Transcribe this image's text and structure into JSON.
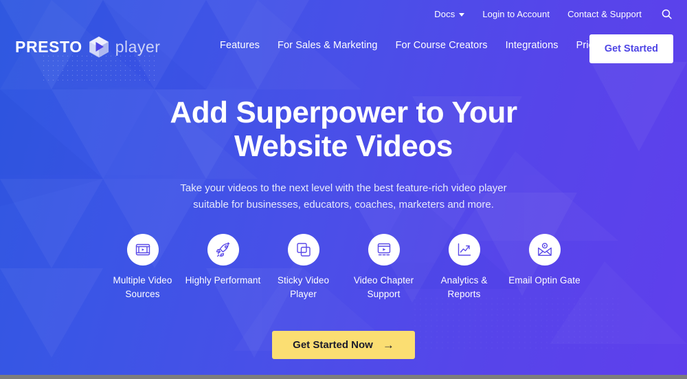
{
  "site": {
    "logo_primary": "PRESTO",
    "logo_secondary": "player",
    "logo_icon": "hexagon-play-icon"
  },
  "topbar": {
    "items": [
      {
        "label": "Docs",
        "icon": "chevron-down-icon",
        "has_caret": true
      },
      {
        "label": "Login to Account",
        "has_caret": false
      },
      {
        "label": "Contact & Support",
        "has_caret": false
      }
    ],
    "search_icon": "search-icon"
  },
  "mainnav": {
    "items": [
      {
        "label": "Features"
      },
      {
        "label": "For Sales & Marketing"
      },
      {
        "label": "For Course Creators"
      },
      {
        "label": "Integrations"
      },
      {
        "label": "Pricing"
      }
    ],
    "cta_label": "Get Started"
  },
  "hero": {
    "heading": "Add Superpower to Your Website Videos",
    "subheading": "Take your videos to the next level with the best feature-rich video player suitable for businesses, educators, coaches, marketers and more."
  },
  "features": [
    {
      "label": "Multiple Video Sources",
      "icon": "film-play-icon"
    },
    {
      "label": "Highly Performant",
      "icon": "rocket-icon"
    },
    {
      "label": "Sticky Video Player",
      "icon": "stacked-layers-icon"
    },
    {
      "label": "Video Chapter Support",
      "icon": "video-chapters-icon"
    },
    {
      "label": "Analytics & Reports",
      "icon": "chart-trend-up-icon"
    },
    {
      "label": "Email Optin Gate",
      "icon": "envelope-play-icon"
    }
  ],
  "cta": {
    "label": "Get Started Now",
    "arrow_icon": "arrow-right-icon"
  },
  "colors": {
    "gradient_start": "#2f58e0",
    "gradient_end": "#5f3fec",
    "accent_yellow": "#fbde72",
    "header_cta_text": "#4f46e5",
    "icon_stroke": "#5b4ae8",
    "bottom_strip": "#7d7d7d"
  }
}
